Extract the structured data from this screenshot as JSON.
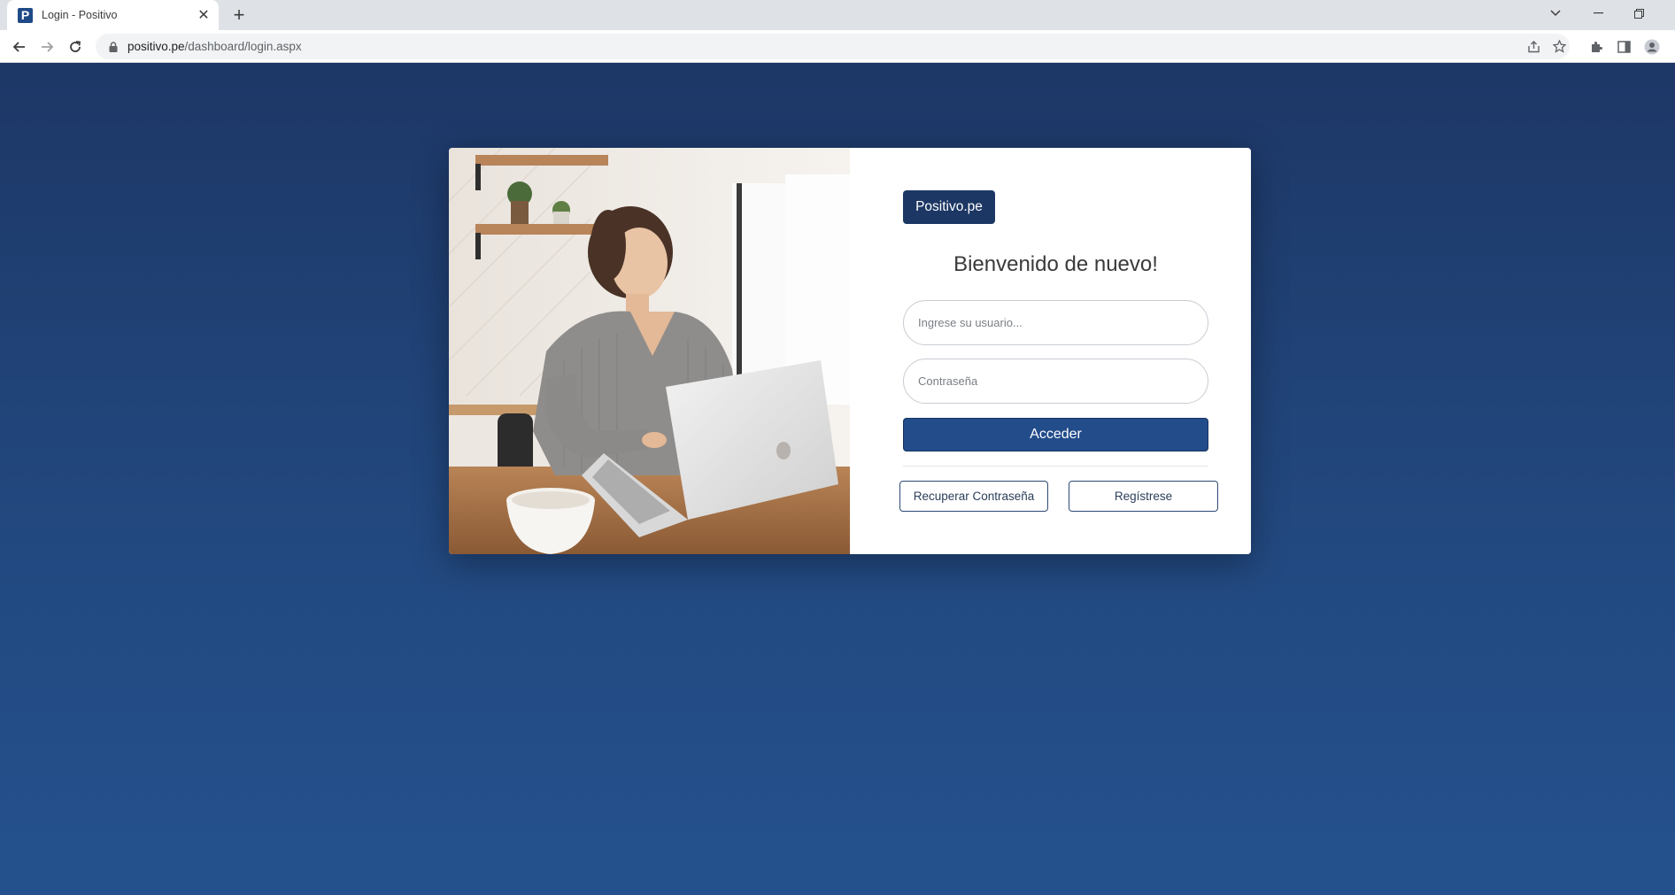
{
  "browser": {
    "tab_title": "Login - Positivo",
    "favicon_letter": "P",
    "url_domain": "positivo.pe",
    "url_path": "/dashboard/login.aspx"
  },
  "login": {
    "brand_label": "Positivo.pe",
    "welcome_heading": "Bienvenido de nuevo!",
    "username_placeholder": "Ingrese su usuario...",
    "password_placeholder": "Contraseña",
    "submit_label": "Acceder",
    "recover_label": "Recuperar Contraseña",
    "register_label": "Regístrese"
  },
  "colors": {
    "page_background": "#22487f",
    "brand_badge": "#1c3764",
    "primary_button": "#234c8b",
    "card_background": "#ffffff"
  }
}
